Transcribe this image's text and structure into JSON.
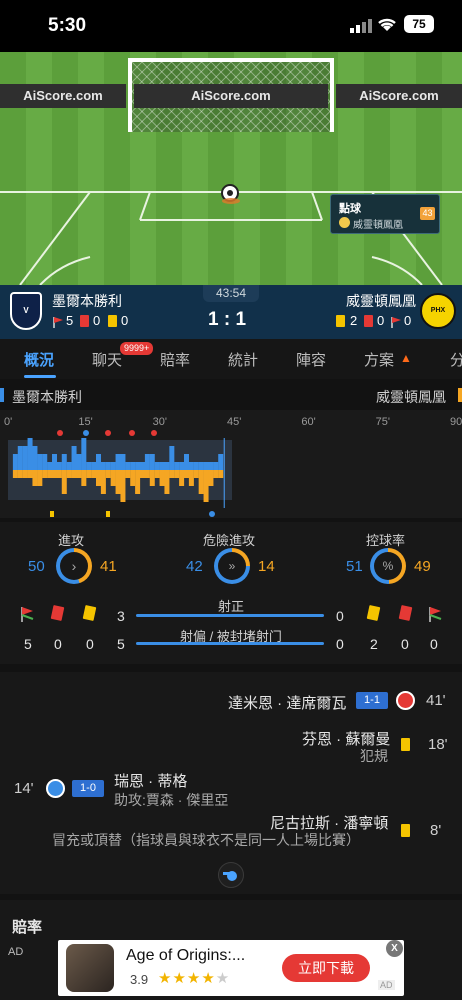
{
  "status": {
    "time": "5:30",
    "battery": "75"
  },
  "pitch": {
    "ad_boards": [
      "AiScore.com",
      "AiScore.com",
      "AiScore.com"
    ],
    "event_title": "點球",
    "event_team": "威靈頓鳳凰",
    "event_minute": "43"
  },
  "score": {
    "home": "墨爾本勝利",
    "away": "威靈頓鳳凰",
    "clock": "43:54",
    "score_text": "1 : 1",
    "home_corners": "5",
    "home_red": "0",
    "home_yellow": "0",
    "away_yellow": "2",
    "away_red": "0",
    "away_corners": "0"
  },
  "tabs": [
    "概況",
    "聊天",
    "賠率",
    "統計",
    "陣容",
    "方案",
    "分"
  ],
  "chat_badge": "9999+",
  "timeline": {
    "home": "墨爾本勝利",
    "away": "威靈頓鳳凰",
    "ticks": [
      "0'",
      "15'",
      "30'",
      "45'",
      "60'",
      "75'",
      "90'"
    ]
  },
  "stats": {
    "attack": {
      "label": "進攻",
      "home": "50",
      "away": "41"
    },
    "danger": {
      "label": "危險進攻",
      "home": "42",
      "away": "14"
    },
    "possession": {
      "label": "控球率",
      "home": "51",
      "away": "49"
    },
    "on_target": {
      "label": "射正",
      "home": "3",
      "away": "0"
    },
    "off_target": {
      "label": "射偏 / 被封堵射门",
      "home": "5",
      "away": "0"
    },
    "home_corners": "5",
    "home_red": "0",
    "home_yellow": "0",
    "away_yellow": "2",
    "away_red": "0",
    "away_corners": "0"
  },
  "events": [
    {
      "player": "達米恩 · 達席爾瓦",
      "score": "1-1",
      "minute": "41'"
    },
    {
      "player": "芬恩 · 蘇爾曼",
      "detail": "犯規",
      "minute": "18'"
    },
    {
      "player": "瑞恩 · 蒂格",
      "detail": "助攻:賈森 · 傑里亞",
      "score": "1-0",
      "minute": "14'"
    },
    {
      "player": "尼古拉斯 · 潘寧頓",
      "detail": "冒充或頂替（指球員與球衣不是同一人上場比賽）",
      "minute": "8'"
    }
  ],
  "odds_title": "賠率",
  "ad": {
    "label": "AD",
    "title": "Age of Origins:...",
    "rating": "3.9",
    "cta": "立即下載",
    "close": "X",
    "corner": "AD"
  },
  "colors": {
    "home": "#3a8ee6",
    "away": "#f5a623",
    "accent": "#4aa3ff"
  },
  "chart_data": {
    "type": "bar",
    "x": [
      1,
      2,
      3,
      4,
      5,
      6,
      7,
      8,
      9,
      10,
      11,
      12,
      13,
      14,
      15,
      16,
      17,
      18,
      19,
      20,
      21,
      22,
      23,
      24,
      25,
      26,
      27,
      28,
      29,
      30,
      31,
      32,
      33,
      34,
      35,
      36,
      37,
      38,
      39,
      40,
      41,
      42,
      43
    ],
    "series": [
      {
        "name": "墨爾本勝利",
        "values": [
          2,
          3,
          3,
          4,
          3,
          2,
          2,
          1,
          2,
          1,
          2,
          1,
          3,
          2,
          4,
          1,
          1,
          2,
          1,
          1,
          1,
          2,
          2,
          1,
          1,
          1,
          1,
          2,
          2,
          1,
          1,
          1,
          3,
          1,
          1,
          2,
          1,
          1,
          1,
          1,
          1,
          1,
          2
        ]
      },
      {
        "name": "威靈頓鳳凰",
        "values": [
          1,
          1,
          1,
          1,
          2,
          2,
          1,
          1,
          1,
          1,
          3,
          1,
          1,
          1,
          2,
          1,
          1,
          2,
          3,
          1,
          2,
          3,
          4,
          1,
          2,
          3,
          1,
          1,
          2,
          1,
          2,
          3,
          1,
          1,
          2,
          1,
          2,
          1,
          3,
          4,
          2,
          1,
          1
        ]
      }
    ],
    "xlim": [
      0,
      90
    ]
  }
}
